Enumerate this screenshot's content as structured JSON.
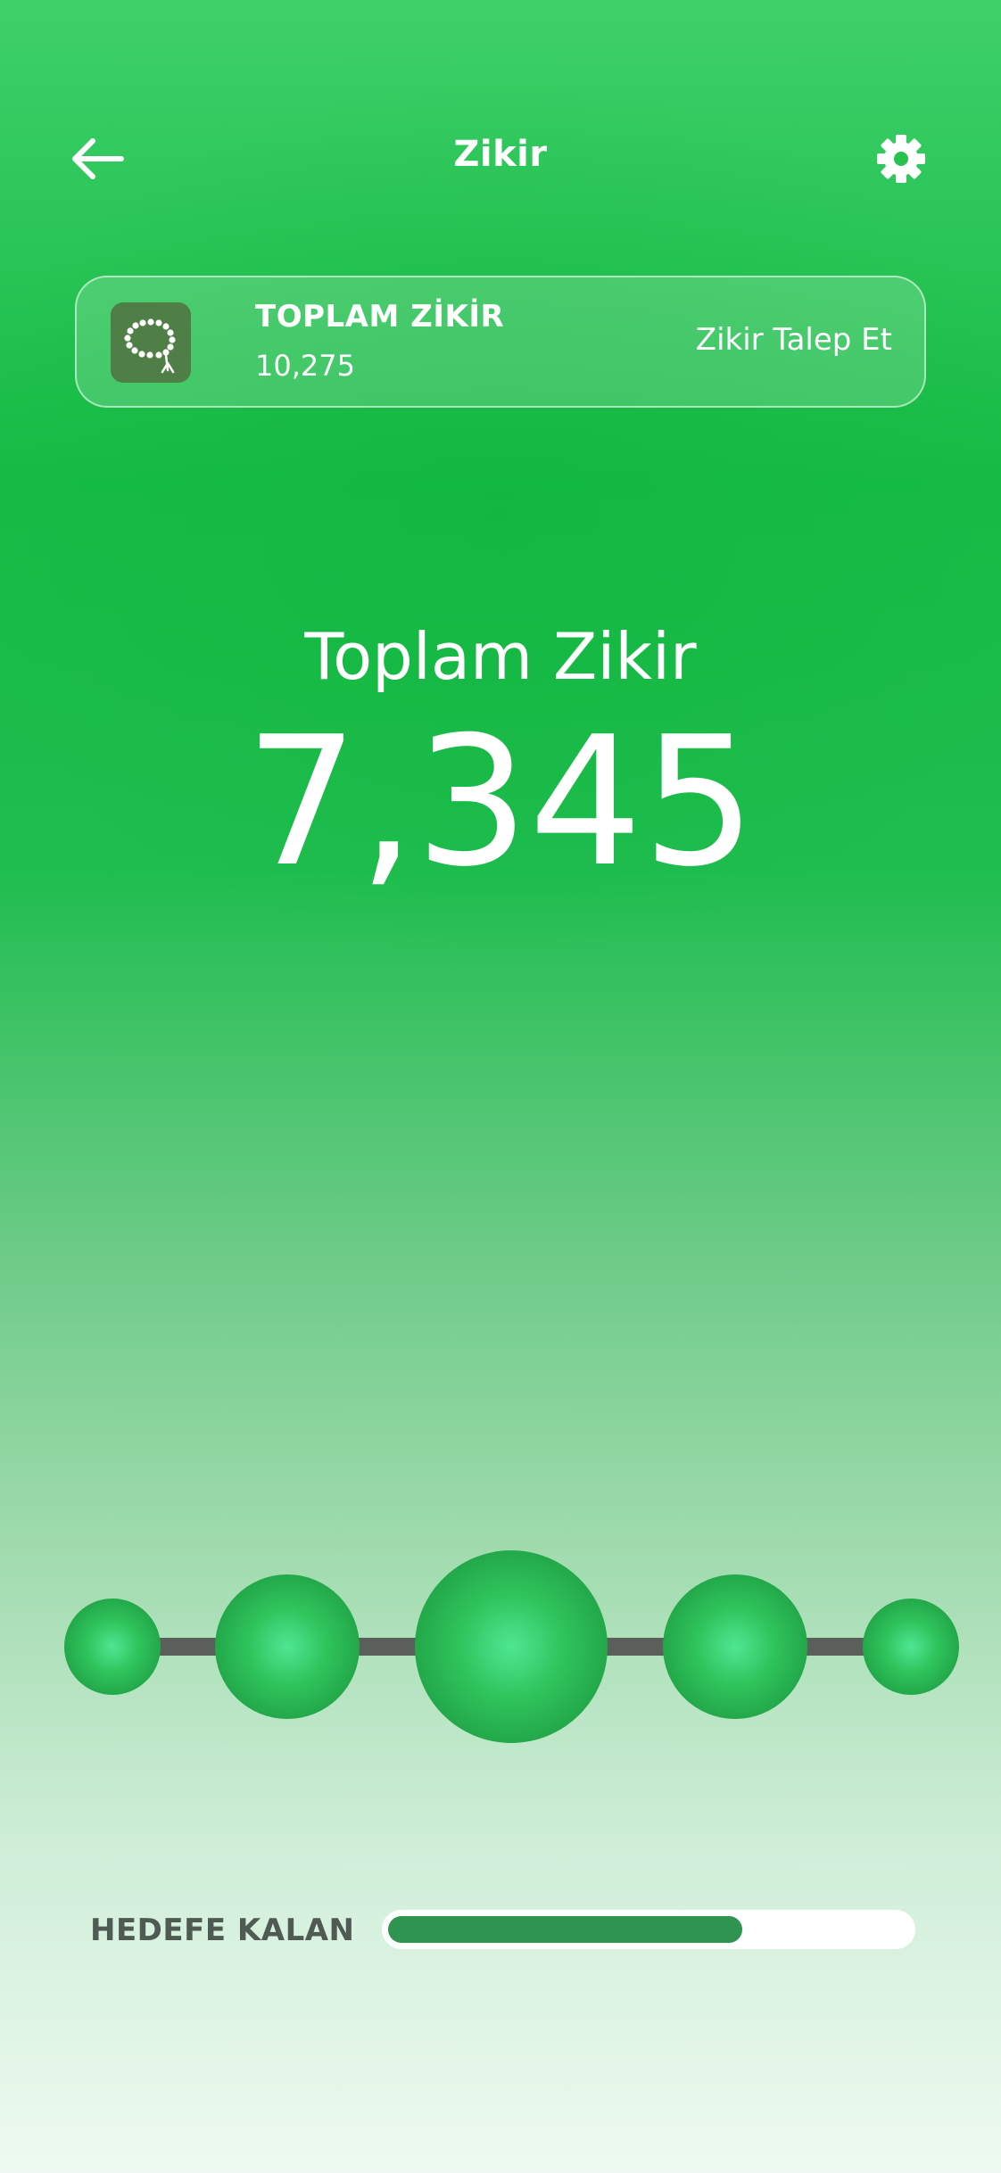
{
  "header": {
    "title": "Zikir",
    "back_icon": "arrow-left-icon",
    "settings_icon": "gear-icon"
  },
  "summary_card": {
    "icon": "tesbih-icon",
    "label": "TOPLAM ZİKİR",
    "value": "10,275",
    "action_label": "Zikir Talep Et"
  },
  "counter": {
    "label": "Toplam Zikir",
    "value": "7,345"
  },
  "beads": {
    "count": 5,
    "color": "#2dbd58"
  },
  "goal": {
    "label": "HEDEFE KALAN",
    "progress_fraction": 0.68
  },
  "colors": {
    "accent": "#16bb45",
    "progress": "#2e944f",
    "tile": "#4f7e47"
  }
}
